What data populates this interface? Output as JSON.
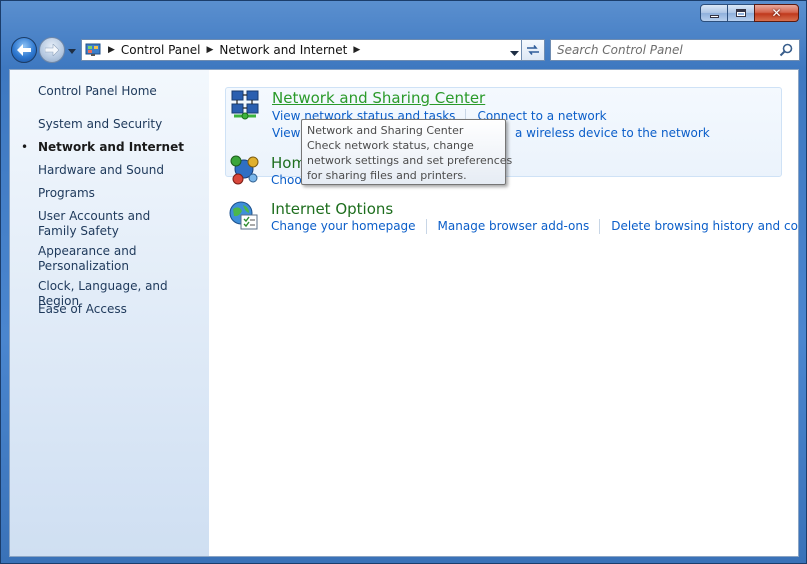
{
  "window": {
    "close_glyph": "✕"
  },
  "navigation": {
    "back_icon": "back-arrow-icon",
    "forward_icon": "forward-arrow-icon"
  },
  "address_bar": {
    "breadcrumbs": [
      "Control Panel",
      "Network and Internet"
    ]
  },
  "search": {
    "placeholder": "Search Control Panel"
  },
  "sidebar": {
    "home": "Control Panel Home",
    "items": [
      {
        "label": "System and Security",
        "active": false
      },
      {
        "label": "Network and Internet",
        "active": true
      },
      {
        "label": "Hardware and Sound",
        "active": false
      },
      {
        "label": "Programs",
        "active": false
      },
      {
        "label": "User Accounts and Family Safety",
        "active": false
      },
      {
        "label": "Appearance and Personalization",
        "active": false
      },
      {
        "label": "Clock, Language, and Region",
        "active": false
      },
      {
        "label": "Ease of Access",
        "active": false
      }
    ]
  },
  "groups": [
    {
      "title": "Network and Sharing Center",
      "icon": "network-sharing-icon",
      "link_rows": [
        [
          "View network status and tasks",
          "Connect to a network"
        ],
        [
          "View ne",
          "a wireless device to the network"
        ]
      ]
    },
    {
      "title": "Home",
      "icon": "homegroup-icon",
      "link_rows": [
        [
          "Choose"
        ]
      ]
    },
    {
      "title": "Internet Options",
      "icon": "internet-options-icon",
      "link_rows": [
        [
          "Change your homepage",
          "Manage browser add-ons",
          "Delete browsing history and cookies"
        ]
      ]
    }
  ],
  "tooltip": {
    "title": "Network and Sharing Center",
    "lines": [
      "Check network status, change",
      "network settings and set preferences",
      "for sharing files and printers."
    ]
  },
  "colors": {
    "frame": "#3e78c0",
    "link": "#0b5ec9",
    "category_title": "#1e6e1e",
    "close_button": "#c0391d"
  }
}
